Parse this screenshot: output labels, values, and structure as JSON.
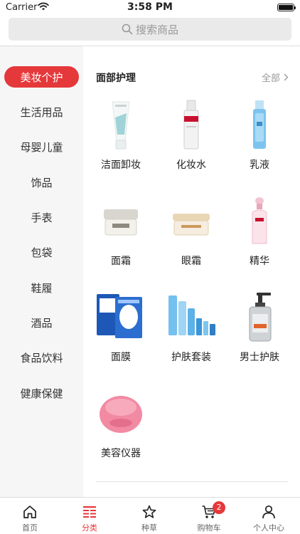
{
  "status_bar": {
    "carrier": "Carrier",
    "time": "3:58 PM"
  },
  "search": {
    "placeholder": "搜索商品"
  },
  "sidebar": {
    "items": [
      {
        "label": "美妆个护",
        "active": true
      },
      {
        "label": "生活用品"
      },
      {
        "label": "母婴儿童"
      },
      {
        "label": "饰品"
      },
      {
        "label": "手表"
      },
      {
        "label": "包袋"
      },
      {
        "label": "鞋履"
      },
      {
        "label": "酒品"
      },
      {
        "label": "食品饮料"
      },
      {
        "label": "健康保健"
      }
    ]
  },
  "section": {
    "title": "面部护理",
    "all_label": "全部",
    "products": [
      {
        "name": "洁面卸妆",
        "icon": "cleanser-tube-icon"
      },
      {
        "name": "化妆水",
        "icon": "toner-bottle-icon"
      },
      {
        "name": "乳液",
        "icon": "lotion-bottle-icon"
      },
      {
        "name": "面霜",
        "icon": "face-cream-jar-icon"
      },
      {
        "name": "眼霜",
        "icon": "eye-cream-jar-icon"
      },
      {
        "name": "精华",
        "icon": "essence-bottle-icon"
      },
      {
        "name": "面膜",
        "icon": "face-mask-icon"
      },
      {
        "name": "护肤套装",
        "icon": "skincare-set-icon"
      },
      {
        "name": "男士护肤",
        "icon": "pump-bottle-icon"
      },
      {
        "name": "美容仪器",
        "icon": "beauty-device-icon"
      }
    ]
  },
  "tabbar": {
    "tabs": [
      {
        "label": "首页",
        "icon": "home-icon"
      },
      {
        "label": "分类",
        "icon": "category-icon",
        "active": true
      },
      {
        "label": "种草",
        "icon": "star-icon"
      },
      {
        "label": "购物车",
        "icon": "cart-icon",
        "badge": "2"
      },
      {
        "label": "个人中心",
        "icon": "person-icon"
      }
    ]
  },
  "colors": {
    "accent": "#e5383b",
    "sidebar_bg": "#f6f6f6",
    "search_bg": "#eaeaea"
  }
}
